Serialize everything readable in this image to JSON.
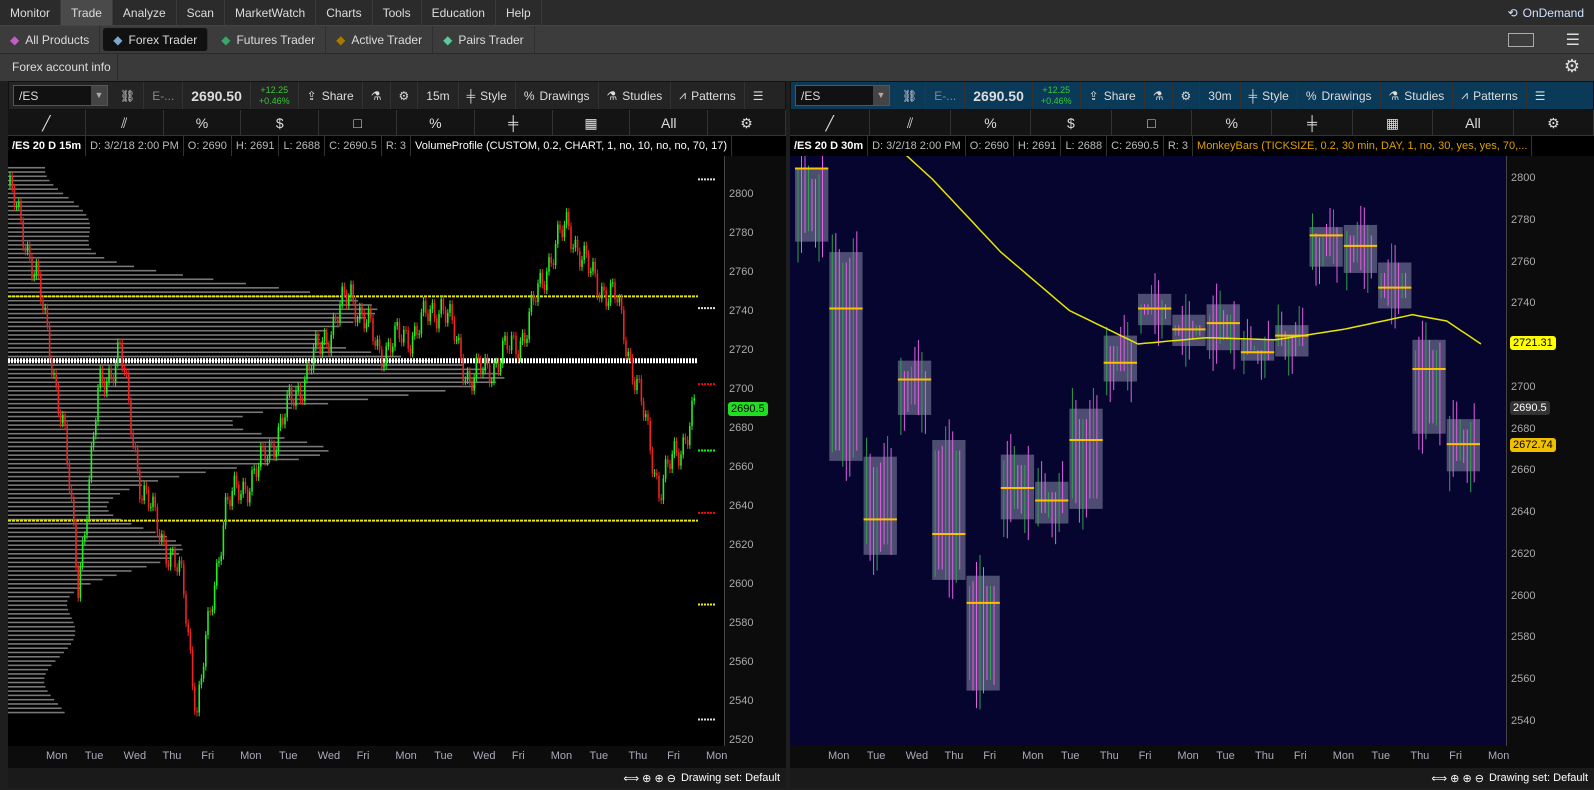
{
  "menu": [
    "Monitor",
    "Trade",
    "Analyze",
    "Scan",
    "MarketWatch",
    "Charts",
    "Tools",
    "Education",
    "Help"
  ],
  "menu_active": "Trade",
  "ondemand": "OnDemand",
  "subtabs": [
    {
      "label": "All Products",
      "color": "#c060c0"
    },
    {
      "label": "Forex Trader",
      "color": "#7ac"
    },
    {
      "label": "Futures Trader",
      "color": "#3a6"
    },
    {
      "label": "Active Trader",
      "color": "#a70"
    },
    {
      "label": "Pairs Trader",
      "color": "#5c9"
    }
  ],
  "subtab_active": "Forex Trader",
  "account_tab": "Forex account info",
  "left": {
    "symbol": "/ES",
    "desc": "E-...",
    "price": "2690.50",
    "change": "+12.25",
    "change_pct": "+0.46%",
    "share": "Share",
    "timeframe": "15m",
    "style": "Style",
    "drawings": "Drawings",
    "studies": "Studies",
    "patterns": "Patterns",
    "info": {
      "title": "/ES 20 D 15m",
      "d": "D: 3/2/18 2:00 PM",
      "o": "O: 2690",
      "h": "H: 2691",
      "l": "L: 2688",
      "c": "C: 2690.5",
      "r": "R: 3",
      "study": "VolumeProfile (CUSTOM, 0.2, CHART, 1, no, 10, no, no, 70, 17)"
    },
    "yticks": [
      2800,
      2780,
      2760,
      2740,
      2720,
      2700,
      2680,
      2660,
      2640,
      2620,
      2600,
      2580,
      2560,
      2540,
      2520
    ],
    "last_tag": "2690.5",
    "days": [
      "Mon",
      "Tue",
      "Wed",
      "Thu",
      "Fri",
      "Mon",
      "Tue",
      "Wed",
      "Fri",
      "Mon",
      "Tue",
      "Wed",
      "Fri",
      "Mon",
      "Tue",
      "Thu",
      "Fri",
      "Mon"
    ],
    "drawing_set": "Drawing set: Default",
    "levels": {
      "yellow": [
        2748,
        2633
      ],
      "white": 2715
    },
    "path": [
      [
        0,
        2805
      ],
      [
        0.04,
        2760
      ],
      [
        0.08,
        2680
      ],
      [
        0.1,
        2600
      ],
      [
        0.13,
        2700
      ],
      [
        0.16,
        2720
      ],
      [
        0.19,
        2650
      ],
      [
        0.22,
        2625
      ],
      [
        0.25,
        2600
      ],
      [
        0.27,
        2535
      ],
      [
        0.31,
        2640
      ],
      [
        0.36,
        2660
      ],
      [
        0.4,
        2690
      ],
      [
        0.45,
        2725
      ],
      [
        0.49,
        2750
      ],
      [
        0.53,
        2720
      ],
      [
        0.58,
        2730
      ],
      [
        0.62,
        2745
      ],
      [
        0.66,
        2705
      ],
      [
        0.7,
        2715
      ],
      [
        0.74,
        2730
      ],
      [
        0.77,
        2765
      ],
      [
        0.8,
        2785
      ],
      [
        0.83,
        2760
      ],
      [
        0.87,
        2745
      ],
      [
        0.9,
        2700
      ],
      [
        0.93,
        2650
      ],
      [
        0.96,
        2670
      ],
      [
        0.98,
        2690.5
      ]
    ]
  },
  "right": {
    "symbol": "/ES",
    "desc": "E-...",
    "price": "2690.50",
    "change": "+12.25",
    "change_pct": "+0.46%",
    "share": "Share",
    "timeframe": "30m",
    "style": "Style",
    "drawings": "Drawings",
    "studies": "Studies",
    "patterns": "Patterns",
    "info": {
      "title": "/ES 20 D 30m",
      "d": "D: 3/2/18 2:00 PM",
      "o": "O: 2690",
      "h": "H: 2691",
      "l": "L: 2688",
      "c": "C: 2690.5",
      "r": "R: 3",
      "study": "MonkeyBars (TICKSIZE, 0.2, 30 min, DAY, 1, no, 30, yes, yes, 70,..."
    },
    "yticks": [
      2800,
      2780,
      2760,
      2740,
      2720,
      2700,
      2680,
      2660,
      2640,
      2620,
      2600,
      2580,
      2560,
      2540
    ],
    "tags": {
      "ma": "2721.31",
      "last": "2690.5",
      "poc": "2672.74"
    },
    "days": [
      "Mon",
      "Tue",
      "Wed",
      "Thu",
      "Fri",
      "Mon",
      "Tue",
      "Thu",
      "Fri",
      "Mon",
      "Tue",
      "Thu",
      "Fri",
      "Mon",
      "Tue",
      "Thu",
      "Fri",
      "Mon"
    ],
    "drawing_set": "Drawing set: Default",
    "boxes": [
      [
        2770,
        2805,
        2805
      ],
      [
        2665,
        2765,
        2738
      ],
      [
        2620,
        2667,
        2637
      ],
      [
        2687,
        2713,
        2704
      ],
      [
        2608,
        2675,
        2630
      ],
      [
        2555,
        2610,
        2597
      ],
      [
        2637,
        2668,
        2652
      ],
      [
        2635,
        2655,
        2646
      ],
      [
        2642,
        2690,
        2675
      ],
      [
        2703,
        2725,
        2712
      ],
      [
        2730,
        2745,
        2738
      ],
      [
        2720,
        2735,
        2728
      ],
      [
        2718,
        2740,
        2731
      ],
      [
        2713,
        2723,
        2717
      ],
      [
        2715,
        2730,
        2725
      ],
      [
        2758,
        2777,
        2773
      ],
      [
        2755,
        2778,
        2768
      ],
      [
        2738,
        2760,
        2748
      ],
      [
        2678,
        2723,
        2709
      ],
      [
        2660,
        2685,
        2673
      ]
    ],
    "ma": [
      [
        0.1,
        2830
      ],
      [
        0.2,
        2800
      ],
      [
        0.3,
        2765
      ],
      [
        0.4,
        2737
      ],
      [
        0.5,
        2721
      ],
      [
        0.6,
        2724
      ],
      [
        0.7,
        2723
      ],
      [
        0.8,
        2728
      ],
      [
        0.9,
        2735
      ],
      [
        0.95,
        2732
      ],
      [
        1,
        2721
      ]
    ]
  },
  "colors": {
    "up": "#22ee22",
    "down": "#ee2222",
    "yellow": "#e6e600",
    "poc": "#ffc000",
    "right_bg": "#050530",
    "toolbar_right": "#0a3a58"
  }
}
